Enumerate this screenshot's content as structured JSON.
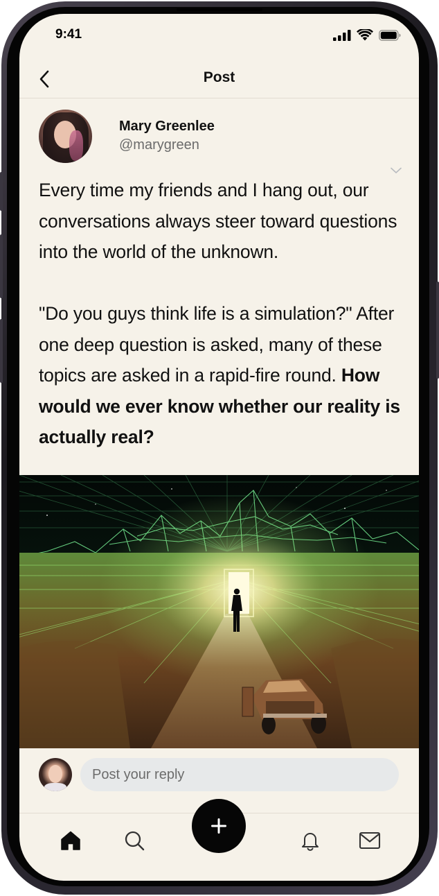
{
  "status_bar": {
    "time": "9:41"
  },
  "header": {
    "title": "Post"
  },
  "post": {
    "author_name": "Mary Greenlee",
    "author_handle": "@marygreen",
    "body_paragraph_1": "Every time my friends and I hang out, our conversations always steer toward questions into the world of the unknown.",
    "body_paragraph_2_plain": "\"Do you guys think life is a simulation?\" After one deep question is asked, many of these topics are asked in a rapid-fire round. ",
    "body_paragraph_2_bold": "How would we ever know whether our reality is actually real?"
  },
  "reply": {
    "placeholder": "Post your reply"
  },
  "tab_bar": {
    "items": [
      "home-icon",
      "search-icon",
      "bell-icon",
      "mail-icon"
    ],
    "compose_icon": "plus-icon"
  },
  "colors": {
    "background": "#f6f2e9",
    "text": "#111111",
    "muted": "#6b6b6b",
    "input_bg": "#e7e9ea",
    "fab": "#060606"
  }
}
